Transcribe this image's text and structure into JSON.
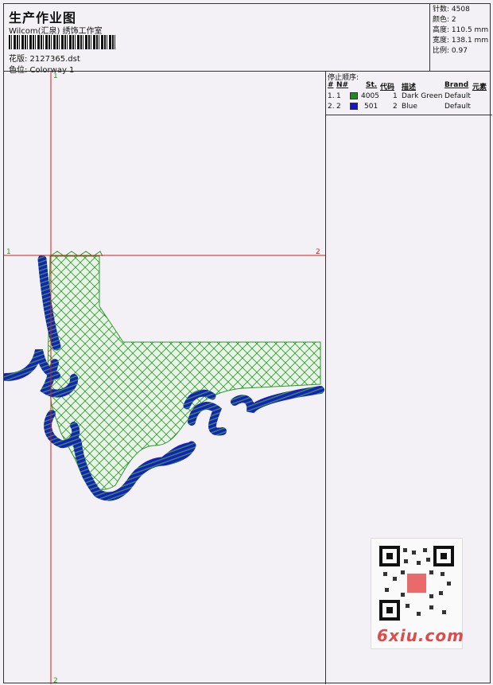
{
  "header": {
    "title": "生产作业图",
    "studio": "Wilcom(汇泉) 绣饰工作室",
    "design": "花版: 2127365.dst",
    "colorway": "色位: Colorway 1"
  },
  "stats": [
    {
      "label": "针数:",
      "value": "4508"
    },
    {
      "label": "颜色:",
      "value": "2"
    },
    {
      "label": "高度:",
      "value": "110.5 mm"
    },
    {
      "label": "宽度:",
      "value": "138.1 mm"
    },
    {
      "label": "比例:",
      "value": "0.97"
    }
  ],
  "stop_order": {
    "title": "停止顺序:",
    "headers": [
      "#",
      "N#",
      "St.",
      "代码",
      "描述",
      "Brand",
      "元素"
    ],
    "rows": [
      {
        "idx": "1.",
        "n": "1",
        "st": "4005",
        "code": "1",
        "desc": "Dark Green",
        "brand": "Default",
        "color": "#1f8a1f"
      },
      {
        "idx": "2.",
        "n": "2",
        "st": "501",
        "code": "2",
        "desc": "Blue",
        "brand": "Default",
        "color": "#1515cc"
      }
    ]
  },
  "guides": {
    "v_top": "1",
    "v_bottom": "2",
    "h_left": "1",
    "h_right": "2"
  },
  "watermark": "6xiu.com",
  "colors": {
    "green": "#2a9a2a",
    "blue": "#1a1ad0",
    "guide": "#d42020"
  }
}
